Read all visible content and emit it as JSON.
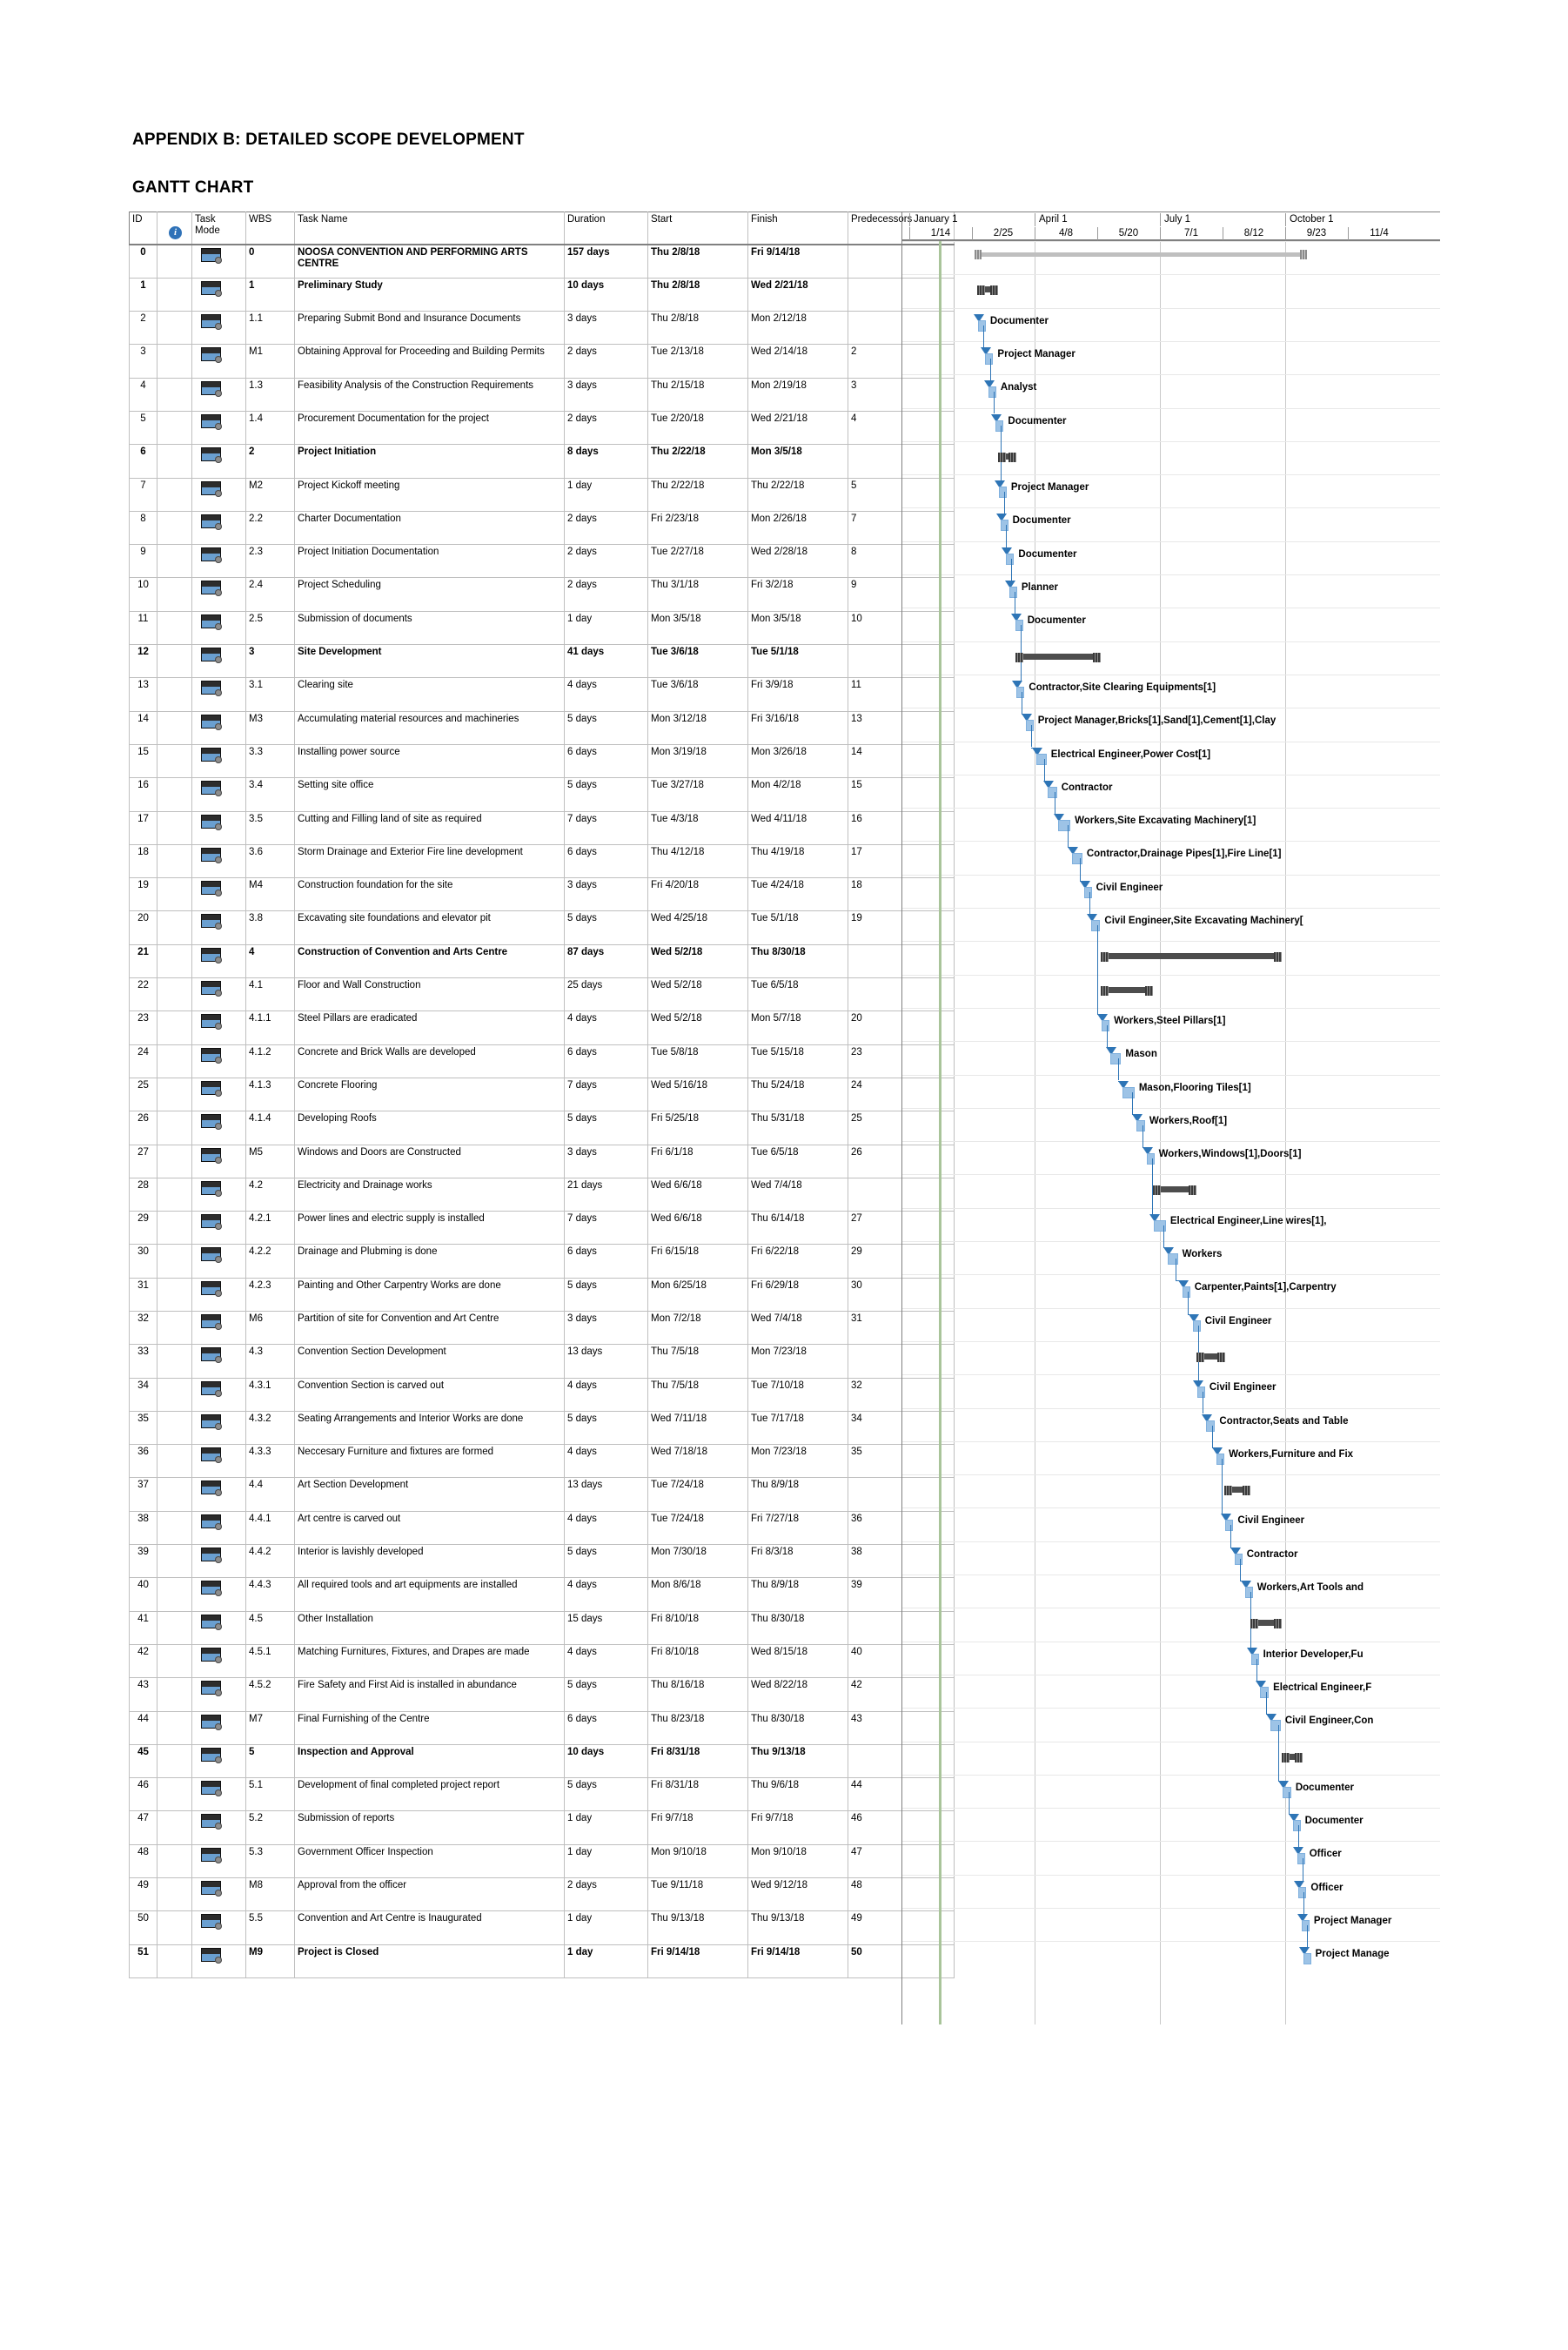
{
  "document": {
    "title": "APPENDIX B: DETAILED SCOPE DEVELOPMENT",
    "subtitle": "GANTT CHART"
  },
  "table": {
    "columns": {
      "id": "ID",
      "info": "info-icon",
      "mode": "Task\nMode",
      "mode_line1": "Task",
      "mode_line2": "Mode",
      "wbs": "WBS",
      "name": "Task Name",
      "duration": "Duration",
      "start": "Start",
      "finish": "Finish",
      "predecessors": "Predecessors"
    }
  },
  "timeline": {
    "quarters": [
      "January 1",
      "April 1",
      "July 1",
      "October 1"
    ],
    "weeks": [
      "1/14",
      "2/25",
      "4/8",
      "5/20",
      "7/1",
      "8/12",
      "9/23",
      "11/4"
    ]
  },
  "chart_data": {
    "type": "gantt",
    "title": "GANTT CHART",
    "project_start": "Thu 2/8/18",
    "project_finish": "Fri 9/14/18",
    "axis_quarters": [
      "January 1",
      "April 1",
      "July 1",
      "October 1"
    ],
    "axis_weeks": [
      "1/14",
      "2/25",
      "4/8",
      "5/20",
      "7/1",
      "8/12",
      "9/23",
      "11/4"
    ],
    "rows": [
      {
        "id": "0",
        "wbs": "0",
        "name": "NOOSA CONVENTION AND PERFORMING ARTS CENTRE",
        "duration": "157 days",
        "start": "Thu 2/8/18",
        "finish": "Fri 9/14/18",
        "pred": "",
        "level": 0,
        "bartype": "project",
        "resource": ""
      },
      {
        "id": "1",
        "wbs": "1",
        "name": "Preliminary Study",
        "duration": "10 days",
        "start": "Thu 2/8/18",
        "finish": "Wed 2/21/18",
        "pred": "",
        "level": 1,
        "bartype": "summary",
        "resource": ""
      },
      {
        "id": "2",
        "wbs": "1.1",
        "name": "Preparing Submit Bond and Insurance Documents",
        "duration": "3 days",
        "start": "Thu 2/8/18",
        "finish": "Mon 2/12/18",
        "pred": "",
        "level": 2,
        "bartype": "task",
        "resource": "Documenter"
      },
      {
        "id": "3",
        "wbs": "M1",
        "name": "Obtaining Approval for Proceeding and Building Permits",
        "duration": "2 days",
        "start": "Tue 2/13/18",
        "finish": "Wed 2/14/18",
        "pred": "2",
        "level": 2,
        "bartype": "task",
        "resource": "Project Manager"
      },
      {
        "id": "4",
        "wbs": "1.3",
        "name": "Feasibility Analysis of the Construction Requirements",
        "duration": "3 days",
        "start": "Thu 2/15/18",
        "finish": "Mon 2/19/18",
        "pred": "3",
        "level": 2,
        "bartype": "task",
        "resource": "Analyst"
      },
      {
        "id": "5",
        "wbs": "1.4",
        "name": "Procurement Documentation for the project",
        "duration": "2 days",
        "start": "Tue 2/20/18",
        "finish": "Wed 2/21/18",
        "pred": "4",
        "level": 2,
        "bartype": "task",
        "resource": "Documenter"
      },
      {
        "id": "6",
        "wbs": "2",
        "name": "Project Initiation",
        "duration": "8 days",
        "start": "Thu 2/22/18",
        "finish": "Mon 3/5/18",
        "pred": "",
        "level": 1,
        "bartype": "summary",
        "resource": ""
      },
      {
        "id": "7",
        "wbs": "M2",
        "name": "Project Kickoff meeting",
        "duration": "1 day",
        "start": "Thu 2/22/18",
        "finish": "Thu 2/22/18",
        "pred": "5",
        "level": 2,
        "bartype": "task",
        "resource": "Project Manager"
      },
      {
        "id": "8",
        "wbs": "2.2",
        "name": "Charter Documentation",
        "duration": "2 days",
        "start": "Fri 2/23/18",
        "finish": "Mon 2/26/18",
        "pred": "7",
        "level": 2,
        "bartype": "task",
        "resource": "Documenter"
      },
      {
        "id": "9",
        "wbs": "2.3",
        "name": "Project Initiation Documentation",
        "duration": "2 days",
        "start": "Tue 2/27/18",
        "finish": "Wed 2/28/18",
        "pred": "8",
        "level": 2,
        "bartype": "task",
        "resource": "Documenter"
      },
      {
        "id": "10",
        "wbs": "2.4",
        "name": "Project Scheduling",
        "duration": "2 days",
        "start": "Thu 3/1/18",
        "finish": "Fri 3/2/18",
        "pred": "9",
        "level": 2,
        "bartype": "task",
        "resource": "Planner"
      },
      {
        "id": "11",
        "wbs": "2.5",
        "name": "Submission of documents",
        "duration": "1 day",
        "start": "Mon 3/5/18",
        "finish": "Mon 3/5/18",
        "pred": "10",
        "level": 2,
        "bartype": "task",
        "resource": "Documenter"
      },
      {
        "id": "12",
        "wbs": "3",
        "name": "Site Development",
        "duration": "41 days",
        "start": "Tue 3/6/18",
        "finish": "Tue 5/1/18",
        "pred": "",
        "level": 1,
        "bartype": "summary",
        "resource": ""
      },
      {
        "id": "13",
        "wbs": "3.1",
        "name": "Clearing site",
        "duration": "4 days",
        "start": "Tue 3/6/18",
        "finish": "Fri 3/9/18",
        "pred": "11",
        "level": 2,
        "bartype": "task",
        "resource": "Contractor,Site Clearing Equipments[1]"
      },
      {
        "id": "14",
        "wbs": "M3",
        "name": "Accumulating material resources and machineries",
        "duration": "5 days",
        "start": "Mon 3/12/18",
        "finish": "Fri 3/16/18",
        "pred": "13",
        "level": 2,
        "bartype": "task",
        "resource": "Project Manager,Bricks[1],Sand[1],Cement[1],Clay"
      },
      {
        "id": "15",
        "wbs": "3.3",
        "name": "Installing power source",
        "duration": "6 days",
        "start": "Mon 3/19/18",
        "finish": "Mon 3/26/18",
        "pred": "14",
        "level": 2,
        "bartype": "task",
        "resource": "Electrical Engineer,Power Cost[1]"
      },
      {
        "id": "16",
        "wbs": "3.4",
        "name": "Setting site office",
        "duration": "5 days",
        "start": "Tue 3/27/18",
        "finish": "Mon 4/2/18",
        "pred": "15",
        "level": 2,
        "bartype": "task",
        "resource": "Contractor"
      },
      {
        "id": "17",
        "wbs": "3.5",
        "name": "Cutting and Filling land of site as required",
        "duration": "7 days",
        "start": "Tue 4/3/18",
        "finish": "Wed 4/11/18",
        "pred": "16",
        "level": 2,
        "bartype": "task",
        "resource": "Workers,Site Excavating Machinery[1]"
      },
      {
        "id": "18",
        "wbs": "3.6",
        "name": "Storm Drainage and Exterior Fire line development",
        "duration": "6 days",
        "start": "Thu 4/12/18",
        "finish": "Thu 4/19/18",
        "pred": "17",
        "level": 2,
        "bartype": "task",
        "resource": "Contractor,Drainage Pipes[1],Fire Line[1]"
      },
      {
        "id": "19",
        "wbs": "M4",
        "name": "Construction foundation for the site",
        "duration": "3 days",
        "start": "Fri 4/20/18",
        "finish": "Tue 4/24/18",
        "pred": "18",
        "level": 2,
        "bartype": "task",
        "resource": "Civil Engineer"
      },
      {
        "id": "20",
        "wbs": "3.8",
        "name": "Excavating site foundations and elevator pit",
        "duration": "5 days",
        "start": "Wed 4/25/18",
        "finish": "Tue 5/1/18",
        "pred": "19",
        "level": 2,
        "bartype": "task",
        "resource": "Civil Engineer,Site Excavating Machinery["
      },
      {
        "id": "21",
        "wbs": "4",
        "name": "Construction of Convention and Arts Centre",
        "duration": "87 days",
        "start": "Wed 5/2/18",
        "finish": "Thu 8/30/18",
        "pred": "",
        "level": 1,
        "bartype": "summary",
        "resource": ""
      },
      {
        "id": "22",
        "wbs": "4.1",
        "name": "Floor and Wall Construction",
        "duration": "25 days",
        "start": "Wed 5/2/18",
        "finish": "Tue 6/5/18",
        "pred": "",
        "level": 2,
        "bartype": "summary",
        "resource": ""
      },
      {
        "id": "23",
        "wbs": "4.1.1",
        "name": "Steel Pillars are eradicated",
        "duration": "4 days",
        "start": "Wed 5/2/18",
        "finish": "Mon 5/7/18",
        "pred": "20",
        "level": 3,
        "bartype": "task",
        "resource": "Workers,Steel Pillars[1]"
      },
      {
        "id": "24",
        "wbs": "4.1.2",
        "name": "Concrete and Brick Walls are developed",
        "duration": "6 days",
        "start": "Tue 5/8/18",
        "finish": "Tue 5/15/18",
        "pred": "23",
        "level": 3,
        "bartype": "task",
        "resource": "Mason"
      },
      {
        "id": "25",
        "wbs": "4.1.3",
        "name": "Concrete Flooring",
        "duration": "7 days",
        "start": "Wed 5/16/18",
        "finish": "Thu 5/24/18",
        "pred": "24",
        "level": 3,
        "bartype": "task",
        "resource": "Mason,Flooring Tiles[1]"
      },
      {
        "id": "26",
        "wbs": "4.1.4",
        "name": "Developing Roofs",
        "duration": "5 days",
        "start": "Fri 5/25/18",
        "finish": "Thu 5/31/18",
        "pred": "25",
        "level": 3,
        "bartype": "task",
        "resource": "Workers,Roof[1]"
      },
      {
        "id": "27",
        "wbs": "M5",
        "name": "Windows and Doors are Constructed",
        "duration": "3 days",
        "start": "Fri 6/1/18",
        "finish": "Tue 6/5/18",
        "pred": "26",
        "level": 3,
        "bartype": "task",
        "resource": "Workers,Windows[1],Doors[1]"
      },
      {
        "id": "28",
        "wbs": "4.2",
        "name": "Electricity and Drainage works",
        "duration": "21 days",
        "start": "Wed 6/6/18",
        "finish": "Wed 7/4/18",
        "pred": "",
        "level": 2,
        "bartype": "summary",
        "resource": ""
      },
      {
        "id": "29",
        "wbs": "4.2.1",
        "name": "Power lines and electric supply is installed",
        "duration": "7 days",
        "start": "Wed 6/6/18",
        "finish": "Thu 6/14/18",
        "pred": "27",
        "level": 3,
        "bartype": "task",
        "resource": "Electrical Engineer,Line wires[1],"
      },
      {
        "id": "30",
        "wbs": "4.2.2",
        "name": "Drainage and Plubming is done",
        "duration": "6 days",
        "start": "Fri 6/15/18",
        "finish": "Fri 6/22/18",
        "pred": "29",
        "level": 3,
        "bartype": "task",
        "resource": "Workers"
      },
      {
        "id": "31",
        "wbs": "4.2.3",
        "name": "Painting and Other Carpentry Works are done",
        "duration": "5 days",
        "start": "Mon 6/25/18",
        "finish": "Fri 6/29/18",
        "pred": "30",
        "level": 3,
        "bartype": "task",
        "resource": "Carpenter,Paints[1],Carpentry"
      },
      {
        "id": "32",
        "wbs": "M6",
        "name": "Partition of site for Convention and Art Centre",
        "duration": "3 days",
        "start": "Mon 7/2/18",
        "finish": "Wed 7/4/18",
        "pred": "31",
        "level": 3,
        "bartype": "task",
        "resource": "Civil Engineer"
      },
      {
        "id": "33",
        "wbs": "4.3",
        "name": "Convention Section Development",
        "duration": "13 days",
        "start": "Thu 7/5/18",
        "finish": "Mon 7/23/18",
        "pred": "",
        "level": 2,
        "bartype": "summary",
        "resource": ""
      },
      {
        "id": "34",
        "wbs": "4.3.1",
        "name": "Convention Section is carved out",
        "duration": "4 days",
        "start": "Thu 7/5/18",
        "finish": "Tue 7/10/18",
        "pred": "32",
        "level": 3,
        "bartype": "task",
        "resource": "Civil Engineer"
      },
      {
        "id": "35",
        "wbs": "4.3.2",
        "name": "Seating Arrangements and Interior Works are done",
        "duration": "5 days",
        "start": "Wed 7/11/18",
        "finish": "Tue 7/17/18",
        "pred": "34",
        "level": 3,
        "bartype": "task",
        "resource": "Contractor,Seats and Table"
      },
      {
        "id": "36",
        "wbs": "4.3.3",
        "name": "Neccesary Furniture and fixtures are formed",
        "duration": "4 days",
        "start": "Wed 7/18/18",
        "finish": "Mon 7/23/18",
        "pred": "35",
        "level": 3,
        "bartype": "task",
        "resource": "Workers,Furniture and Fix"
      },
      {
        "id": "37",
        "wbs": "4.4",
        "name": "Art Section Development",
        "duration": "13 days",
        "start": "Tue 7/24/18",
        "finish": "Thu 8/9/18",
        "pred": "",
        "level": 2,
        "bartype": "summary",
        "resource": ""
      },
      {
        "id": "38",
        "wbs": "4.4.1",
        "name": "Art centre is carved out",
        "duration": "4 days",
        "start": "Tue 7/24/18",
        "finish": "Fri 7/27/18",
        "pred": "36",
        "level": 3,
        "bartype": "task",
        "resource": "Civil Engineer"
      },
      {
        "id": "39",
        "wbs": "4.4.2",
        "name": "Interior is lavishly developed",
        "duration": "5 days",
        "start": "Mon 7/30/18",
        "finish": "Fri 8/3/18",
        "pred": "38",
        "level": 3,
        "bartype": "task",
        "resource": "Contractor"
      },
      {
        "id": "40",
        "wbs": "4.4.3",
        "name": "All required tools and art equipments are installed",
        "duration": "4 days",
        "start": "Mon 8/6/18",
        "finish": "Thu 8/9/18",
        "pred": "39",
        "level": 3,
        "bartype": "task",
        "resource": "Workers,Art Tools and"
      },
      {
        "id": "41",
        "wbs": "4.5",
        "name": "Other Installation",
        "duration": "15 days",
        "start": "Fri 8/10/18",
        "finish": "Thu 8/30/18",
        "pred": "",
        "level": 2,
        "bartype": "summary",
        "resource": ""
      },
      {
        "id": "42",
        "wbs": "4.5.1",
        "name": "Matching Furnitures, Fixtures, and Drapes are made",
        "duration": "4 days",
        "start": "Fri 8/10/18",
        "finish": "Wed 8/15/18",
        "pred": "40",
        "level": 3,
        "bartype": "task",
        "resource": "Interior Developer,Fu"
      },
      {
        "id": "43",
        "wbs": "4.5.2",
        "name": "Fire Safety and First Aid is installed in abundance",
        "duration": "5 days",
        "start": "Thu 8/16/18",
        "finish": "Wed 8/22/18",
        "pred": "42",
        "level": 3,
        "bartype": "task",
        "resource": "Electrical Engineer,F"
      },
      {
        "id": "44",
        "wbs": "M7",
        "name": "Final Furnishing of the Centre",
        "duration": "6 days",
        "start": "Thu 8/23/18",
        "finish": "Thu 8/30/18",
        "pred": "43",
        "level": 3,
        "bartype": "task",
        "resource": "Civil Engineer,Con"
      },
      {
        "id": "45",
        "wbs": "5",
        "name": "Inspection and Approval",
        "duration": "10 days",
        "start": "Fri 8/31/18",
        "finish": "Thu 9/13/18",
        "pred": "",
        "level": 1,
        "bartype": "summary",
        "resource": ""
      },
      {
        "id": "46",
        "wbs": "5.1",
        "name": "Development of final completed project report",
        "duration": "5 days",
        "start": "Fri 8/31/18",
        "finish": "Thu 9/6/18",
        "pred": "44",
        "level": 2,
        "bartype": "task",
        "resource": "Documenter"
      },
      {
        "id": "47",
        "wbs": "5.2",
        "name": "Submission of reports",
        "duration": "1 day",
        "start": "Fri 9/7/18",
        "finish": "Fri 9/7/18",
        "pred": "46",
        "level": 2,
        "bartype": "task",
        "resource": "Documenter"
      },
      {
        "id": "48",
        "wbs": "5.3",
        "name": "Government Officer Inspection",
        "duration": "1 day",
        "start": "Mon 9/10/18",
        "finish": "Mon 9/10/18",
        "pred": "47",
        "level": 2,
        "bartype": "task",
        "resource": "Officer"
      },
      {
        "id": "49",
        "wbs": "M8",
        "name": "Approval from the officer",
        "duration": "2 days",
        "start": "Tue 9/11/18",
        "finish": "Wed 9/12/18",
        "pred": "48",
        "level": 2,
        "bartype": "task",
        "resource": "Officer"
      },
      {
        "id": "50",
        "wbs": "5.5",
        "name": "Convention and Art Centre is Inaugurated",
        "duration": "1 day",
        "start": "Thu 9/13/18",
        "finish": "Thu 9/13/18",
        "pred": "49",
        "level": 2,
        "bartype": "task",
        "resource": "Project Manager"
      },
      {
        "id": "51",
        "wbs": "M9",
        "name": "Project is Closed",
        "duration": "1 day",
        "start": "Fri 9/14/18",
        "finish": "Fri 9/14/18",
        "pred": "50",
        "level": 1,
        "bartype": "task",
        "resource": "Project Manage"
      }
    ]
  },
  "colors": {
    "bar_task": "#9dc3e6",
    "bar_summary": "#4d4d4d",
    "bar_project": "#bfbfbf",
    "link": "#2e75b6",
    "today_line": "#a9c49a",
    "grid": "#bfbfbf"
  }
}
